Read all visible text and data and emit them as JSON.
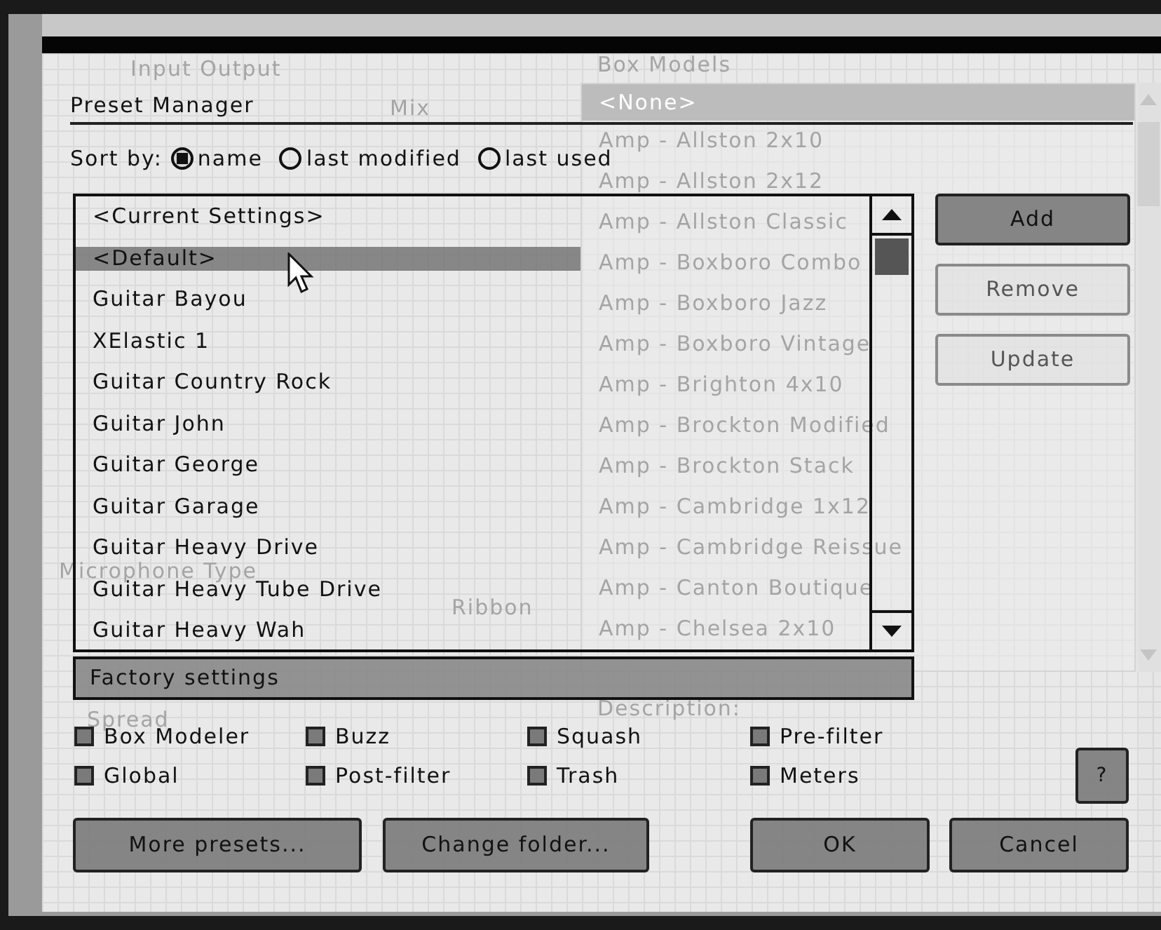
{
  "background_panel": {
    "input_output_label": "Input Output",
    "mix_label": "Mix",
    "box_models_label": "Box Models",
    "box_models": [
      {
        "label": "<None>",
        "selected": true
      },
      {
        "label": "Amp - Allston 2x10",
        "selected": false
      },
      {
        "label": "Amp - Allston 2x12",
        "selected": false
      },
      {
        "label": "Amp - Allston Classic",
        "selected": false
      },
      {
        "label": "Amp - Boxboro Combo",
        "selected": false
      },
      {
        "label": "Amp - Boxboro Jazz",
        "selected": false
      },
      {
        "label": "Amp - Boxboro Vintage",
        "selected": false
      },
      {
        "label": "Amp - Brighton 4x10",
        "selected": false
      },
      {
        "label": "Amp - Brockton Modified",
        "selected": false
      },
      {
        "label": "Amp - Brockton Stack",
        "selected": false
      },
      {
        "label": "Amp - Cambridge 1x12",
        "selected": false
      },
      {
        "label": "Amp - Cambridge Reissue",
        "selected": false
      },
      {
        "label": "Amp - Canton Boutique",
        "selected": false
      },
      {
        "label": "Amp - Chelsea 2x10",
        "selected": false
      }
    ],
    "microphone_type_label": "Microphone Type",
    "ribbon_option": "Ribbon",
    "spread_label": "Spread",
    "description_label": "Description:"
  },
  "dialog": {
    "title": "Preset Manager",
    "sort_label": "Sort by:",
    "sort_options": [
      {
        "label": "name",
        "selected": true
      },
      {
        "label": "last modified",
        "selected": false
      },
      {
        "label": "last used",
        "selected": false
      }
    ],
    "presets": [
      {
        "label": "<Current Settings>",
        "selected": false
      },
      {
        "label": "<Default>",
        "selected": true
      },
      {
        "label": "Guitar Bayou",
        "selected": false
      },
      {
        "label": "XElastic 1",
        "selected": false
      },
      {
        "label": "Guitar Country Rock",
        "selected": false
      },
      {
        "label": "Guitar John",
        "selected": false
      },
      {
        "label": "Guitar George",
        "selected": false
      },
      {
        "label": "Guitar Garage",
        "selected": false
      },
      {
        "label": "Guitar Heavy Drive",
        "selected": false
      },
      {
        "label": "Guitar Heavy Tube Drive",
        "selected": false
      },
      {
        "label": "Guitar Heavy Wah",
        "selected": false
      }
    ],
    "folder_label": "Factory settings",
    "side_buttons": [
      {
        "label": "Add",
        "kind": "primary"
      },
      {
        "label": "Remove",
        "kind": "secondary"
      },
      {
        "label": "Update",
        "kind": "secondary"
      }
    ],
    "categories": [
      {
        "label": "Box Modeler",
        "checked": false
      },
      {
        "label": "Buzz",
        "checked": false
      },
      {
        "label": "Squash",
        "checked": false
      },
      {
        "label": "Pre-filter",
        "checked": false
      },
      {
        "label": "Global",
        "checked": false
      },
      {
        "label": "Post-filter",
        "checked": false
      },
      {
        "label": "Trash",
        "checked": false
      },
      {
        "label": "Meters",
        "checked": false
      }
    ],
    "help_button": "?",
    "footer_left": [
      "More presets...",
      "Change folder..."
    ],
    "footer_right": [
      "OK",
      "Cancel"
    ]
  }
}
